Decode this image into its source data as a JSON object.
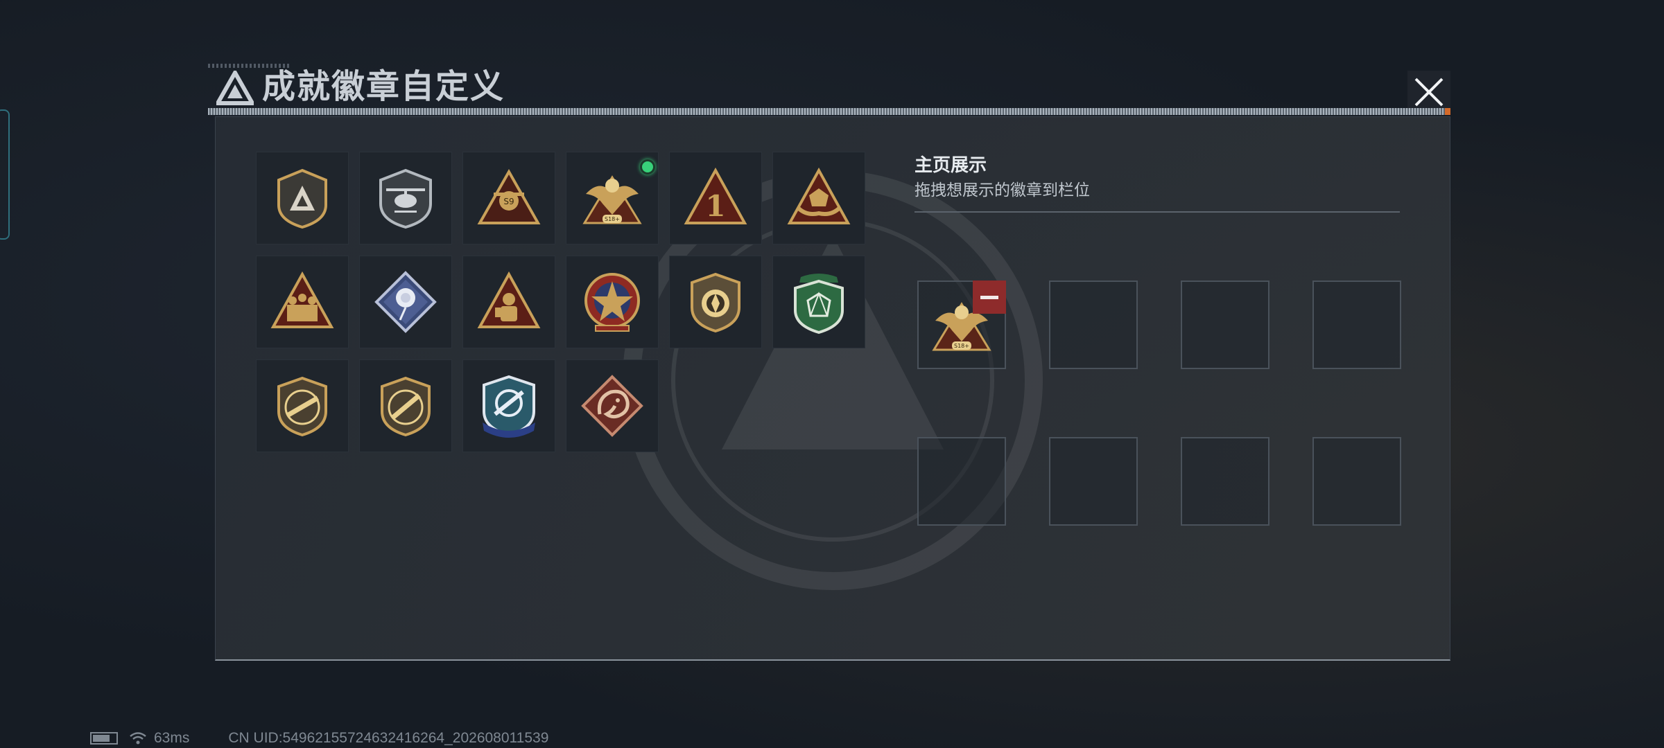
{
  "header": {
    "title": "成就徽章自定义"
  },
  "badges": [
    {
      "icon": "delta-shield-badge-icon"
    },
    {
      "icon": "helicopter-shield-badge-icon"
    },
    {
      "icon": "s9-triangle-badge-icon"
    },
    {
      "icon": "eagle-crest-badge-icon",
      "equipped": true
    },
    {
      "icon": "number-one-triangle-badge-icon"
    },
    {
      "icon": "gem-hands-triangle-badge-icon"
    },
    {
      "icon": "soldiers-triangle-badge-icon"
    },
    {
      "icon": "rose-diamond-badge-icon"
    },
    {
      "icon": "hazmat-triangle-badge-icon"
    },
    {
      "icon": "star-medal-badge-icon"
    },
    {
      "icon": "crossed-arrows-shield-badge-icon"
    },
    {
      "icon": "green-gem-shield-badge-icon"
    },
    {
      "icon": "rifle-shield-badge-icon-1"
    },
    {
      "icon": "rifle-shield-badge-icon-2"
    },
    {
      "icon": "blue-crosshair-shield-badge-icon"
    },
    {
      "icon": "dragon-diamond-badge-icon"
    }
  ],
  "showcase": {
    "title": "主页展示",
    "subtitle": "拖拽想展示的徽章到栏位",
    "slots": [
      {
        "badge": "eagle-crest-badge-icon"
      },
      {
        "badge": null
      },
      {
        "badge": null
      },
      {
        "badge": null
      },
      {
        "badge": null
      },
      {
        "badge": null
      },
      {
        "badge": null
      },
      {
        "badge": null
      }
    ]
  },
  "status": {
    "ping": "63ms",
    "uid": "CN UID:5496215572463241626­4_202608011539"
  },
  "colors": {
    "gold": "#c9a15a",
    "equipped": "#38d17a",
    "remove": "#8e2b2b"
  }
}
